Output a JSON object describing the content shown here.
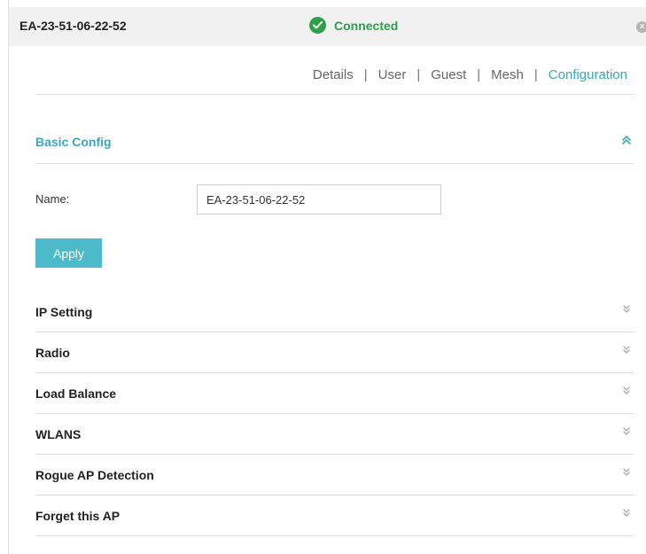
{
  "header": {
    "device_name": "EA-23-51-06-22-52",
    "status": "Connected",
    "status_color": "#2da04a",
    "icons": [
      "check-icon",
      "close-icon"
    ]
  },
  "tabs": [
    {
      "label": "Details",
      "active": false
    },
    {
      "label": "User",
      "active": false
    },
    {
      "label": "Guest",
      "active": false
    },
    {
      "label": "Mesh",
      "active": false
    },
    {
      "label": "Configuration",
      "active": true
    }
  ],
  "tab_separator": "|",
  "accent_color": "#3aa7bd",
  "basic_config": {
    "title": "Basic Config",
    "expanded": true,
    "name_label": "Name:",
    "name_value": "EA-23-51-06-22-52",
    "apply_label": "Apply",
    "apply_color": "#4cbac8"
  },
  "sections": [
    {
      "label": "IP Setting",
      "expanded": false
    },
    {
      "label": "Radio",
      "expanded": false
    },
    {
      "label": "Load Balance",
      "expanded": false
    },
    {
      "label": "WLANS",
      "expanded": false
    },
    {
      "label": "Rogue AP Detection",
      "expanded": false
    },
    {
      "label": "Forget this AP",
      "expanded": false
    }
  ]
}
